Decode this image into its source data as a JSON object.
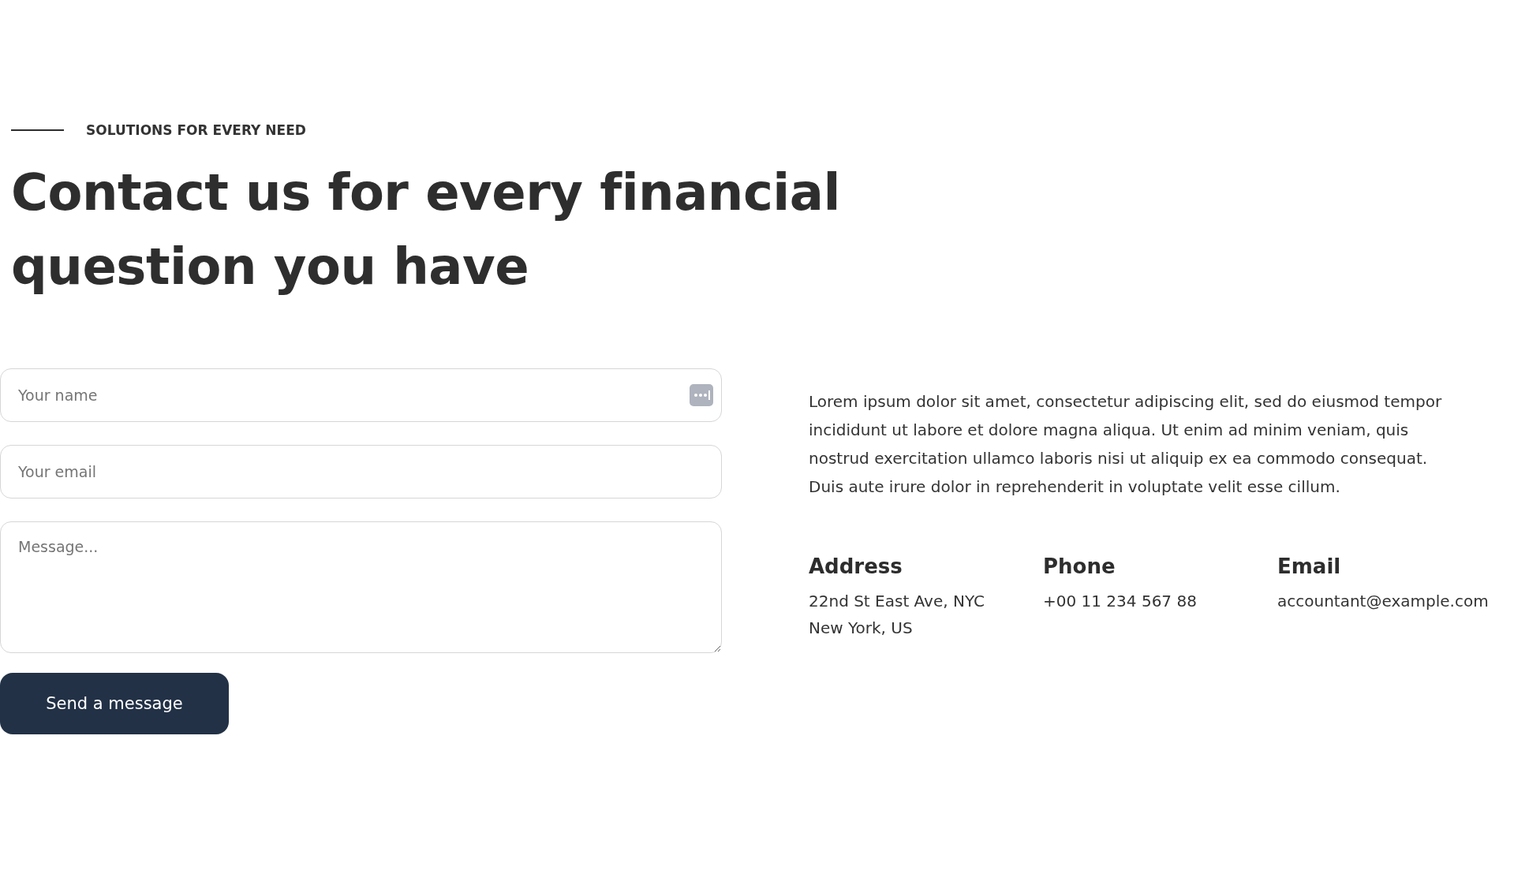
{
  "eyebrow": "SOLUTIONS FOR EVERY NEED",
  "heading": "Contact us for every financial question you have",
  "form": {
    "fields": [
      {
        "kind": "input",
        "placeholder": "Your name",
        "autofill_icon": true
      },
      {
        "kind": "input",
        "placeholder": "Your email",
        "autofill_icon": false
      },
      {
        "kind": "textarea",
        "placeholder": "Message..."
      }
    ],
    "button": "Send a message"
  },
  "intro": "Lorem ipsum dolor sit amet, consectetur adipiscing elit, sed do eiusmod tempor\nincididunt ut labore et dolore magna aliqua. Ut enim ad minim veniam, quis\nnostrud exercitation ullamco laboris nisi ut aliquip ex ea commodo consequat.\nDuis aute irure dolor in reprehenderit in voluptate velit esse cillum.",
  "contacts": [
    {
      "title": "Address",
      "lines": [
        "22nd St East Ave, NYC",
        "New York, US"
      ]
    },
    {
      "title": "Phone",
      "lines": [
        "+00 11 234 567 88"
      ]
    },
    {
      "title": "Email",
      "lines": [
        "accountant@example.com"
      ]
    }
  ]
}
